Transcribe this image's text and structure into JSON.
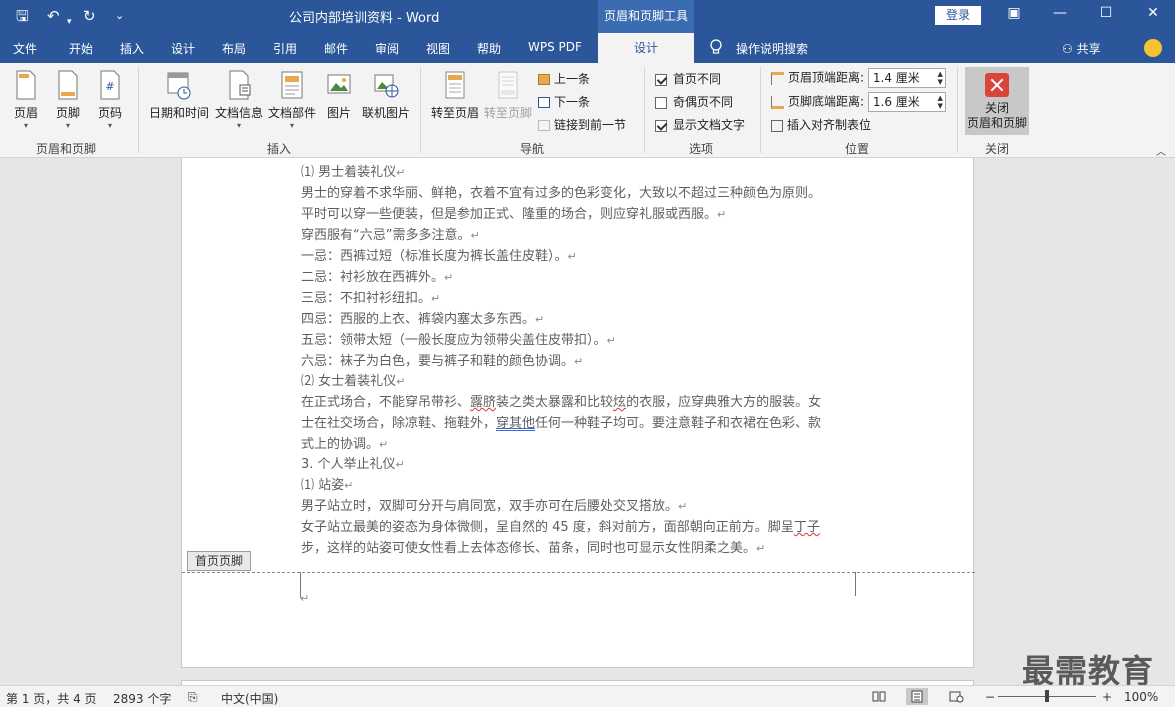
{
  "titlebar": {
    "doc_title": "公司内部培训资料  -  Word",
    "context_tab": "页眉和页脚工具",
    "login": "登录",
    "qa_save": "🖫",
    "qa_undo": "↶",
    "qa_redo": "↻",
    "qa_more": "⌄"
  },
  "menu": {
    "items": [
      "文件",
      "开始",
      "插入",
      "设计",
      "布局",
      "引用",
      "邮件",
      "审阅",
      "视图",
      "帮助",
      "WPS PDF"
    ],
    "active": "设计",
    "search": "操作说明搜索",
    "share": "共享"
  },
  "ribbon": {
    "hf_group": {
      "label": "页眉和页脚",
      "header": "页眉",
      "footer": "页脚",
      "page_number": "页码"
    },
    "insert_group": {
      "label": "插入",
      "datetime": "日期和时间",
      "docinfo": "文档信息",
      "quickparts": "文档部件",
      "picture": "图片",
      "online_picture": "联机图片"
    },
    "nav_group": {
      "label": "导航",
      "goto_header": "转至页眉",
      "goto_footer": "转至页脚",
      "prev": "上一条",
      "next": "下一条",
      "link_prev": "链接到前一节"
    },
    "options_group": {
      "label": "选项",
      "diff_first": "首页不同",
      "diff_first_checked": true,
      "diff_odd_even": "奇偶页不同",
      "diff_odd_even_checked": false,
      "show_doc_text": "显示文档文字",
      "show_doc_text_checked": true
    },
    "position_group": {
      "label": "位置",
      "header_top_label": "页眉顶端距离:",
      "header_top_value": "1.4 厘米",
      "footer_bottom_label": "页脚底端距离:",
      "footer_bottom_value": "1.6 厘米",
      "insert_align_tab": "插入对齐制表位"
    },
    "close_group": {
      "label": "关闭",
      "close_line1": "关闭",
      "close_line2": "页眉和页脚"
    }
  },
  "document": {
    "lines": [
      {
        "text": "⑴ 男士着装礼仪",
        "pm": "↵"
      },
      {
        "text": "男士的穿着不求华丽、鲜艳，衣着不宜有过多的色彩变化，大致以不超过三种颜色为原则。",
        "pm": ""
      },
      {
        "text": "平时可以穿一些便装，但是参加正式、隆重的场合，则应穿礼服或西服。",
        "pm": "↵"
      },
      {
        "text": "穿西服有“六忌”需多多注意。",
        "pm": "↵"
      },
      {
        "text": "一忌：西裤过短（标准长度为裤长盖住皮鞋）。",
        "pm": "↵"
      },
      {
        "text": "二忌：衬衫放在西裤外。",
        "pm": "↵"
      },
      {
        "text": "三忌：不扣衬衫纽扣。",
        "pm": "↵"
      },
      {
        "text": "四忌：西服的上衣、裤袋内塞太多东西。",
        "pm": "↵"
      },
      {
        "text": "五忌：领带太短（一般长度应为领带尖盖住皮带扣）。",
        "pm": "↵"
      },
      {
        "text": "六忌：袜子为白色，要与裤子和鞋的颜色协调。",
        "pm": "↵"
      },
      {
        "text": "⑵ 女士着装礼仪",
        "pm": "↵"
      }
    ],
    "para_women": {
      "l1_a": "在正式场合，不能穿吊带衫、",
      "l1_b": "露脐",
      "l1_c": "装之类太暴露和比较",
      "l1_d": "炫",
      "l1_e": "的衣服，应穿典雅大方的服装。女",
      "l2_a": "士在社交场合，除凉鞋、拖鞋外，",
      "l2_b": "穿其他",
      "l2_c": "任何一种鞋子均可。要注意鞋子和衣裙在色彩、款",
      "l3": "式上的协调。",
      "pm": "↵"
    },
    "lines2": [
      {
        "text": "3. 个人举止礼仪",
        "pm": "↵"
      },
      {
        "text": "⑴ 站姿",
        "pm": "↵"
      },
      {
        "text": "男子站立时，双脚可分开与肩同宽，双手亦可在后腰处交叉搭放。",
        "pm": "↵"
      }
    ],
    "para_stand": {
      "l1_a": "女子站立最美的姿态为身体微侧，呈自然的 45 度，斜对前方，面部朝向正前方。脚呈",
      "l1_b": "丁子",
      "l2": "步，这样的站姿可使女性看上去体态修长、苗条，同时也可显示女性阴柔之美。",
      "pm": "↵"
    },
    "hf_tag": "首页页脚",
    "footer_pm": "↵"
  },
  "watermark": "最需教育",
  "status": {
    "page": "第 1 页，共 4 页",
    "words": "2893 个字",
    "language": "中文(中国)",
    "zoom_minus": "−",
    "zoom_plus": "+",
    "zoom": "100%",
    "zoom_fraction": 0.5
  },
  "colors": {
    "brand": "#2b579a",
    "close_red": "#d9453b"
  }
}
